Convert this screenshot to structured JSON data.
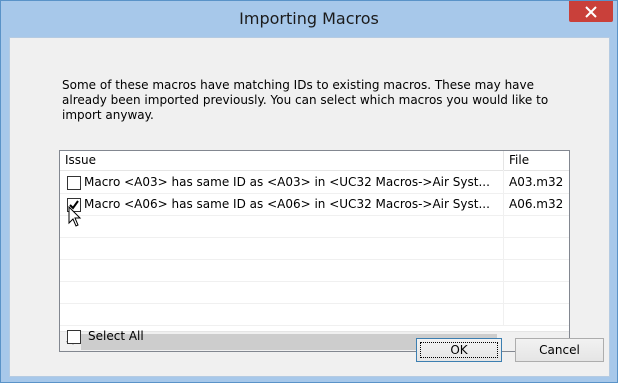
{
  "window": {
    "title": "Importing Macros",
    "close_glyph": "×"
  },
  "message": "Some of these macros have matching IDs to existing macros. These may have already been imported previously. You can select which macros you would like to import anyway.",
  "list": {
    "columns": [
      {
        "label": "Issue"
      },
      {
        "label": "File"
      }
    ],
    "rows": [
      {
        "checked": false,
        "issue": "Macro <A03> has same ID as <A03> in <UC32 Macros->Air Syst...",
        "file": "A03.m32"
      },
      {
        "checked": true,
        "issue": "Macro <A06> has same ID as <A06> in <UC32 Macros->Air Syst...",
        "file": "A06.m32"
      }
    ],
    "scroll_left": "<",
    "scroll_right": ">"
  },
  "select_all": {
    "label": "Select All",
    "checked": false
  },
  "buttons": {
    "ok": "OK",
    "cancel": "Cancel"
  },
  "colors": {
    "titlebar": "#a7c8ea",
    "close": "#c9403a"
  }
}
